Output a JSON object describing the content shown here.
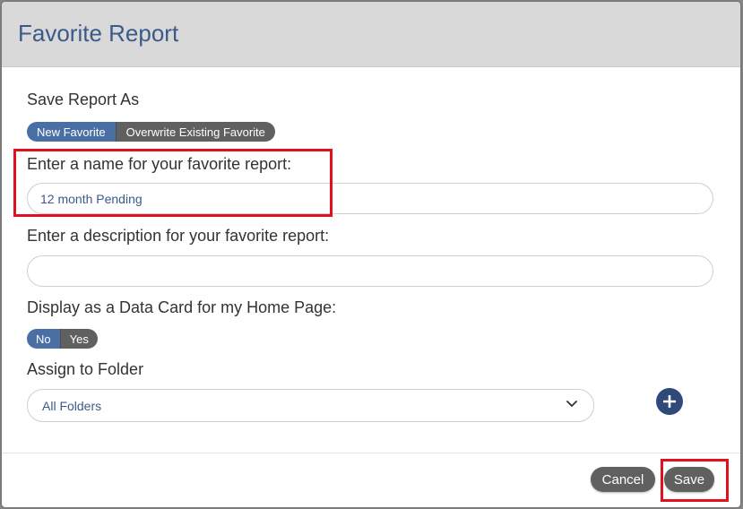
{
  "dialog": {
    "title": "Favorite Report",
    "save_as": {
      "label": "Save Report As",
      "options": [
        "New Favorite",
        "Overwrite Existing Favorite"
      ],
      "selected": "New Favorite"
    },
    "name_field": {
      "label": "Enter a name for your favorite report:",
      "value": "12 month Pending",
      "placeholder": ""
    },
    "description_field": {
      "label": "Enter a description for your favorite report:",
      "value": "",
      "placeholder": ""
    },
    "data_card": {
      "label": "Display as a Data Card for my Home Page:",
      "options": [
        "No",
        "Yes"
      ],
      "selected": "No"
    },
    "folder": {
      "label": "Assign to Folder",
      "selected": "All Folders"
    },
    "footer": {
      "cancel_label": "Cancel",
      "save_label": "Save"
    }
  },
  "colors": {
    "title": "#3b5a8a",
    "toggle_active": "#4a6fa5",
    "toggle_inactive": "#606060",
    "add_button": "#2f4a7a",
    "highlight": "#e0101e",
    "footer_button": "#606060"
  },
  "icons": {
    "select_chevron": "chevron-down-icon",
    "add_folder": "plus-icon"
  }
}
